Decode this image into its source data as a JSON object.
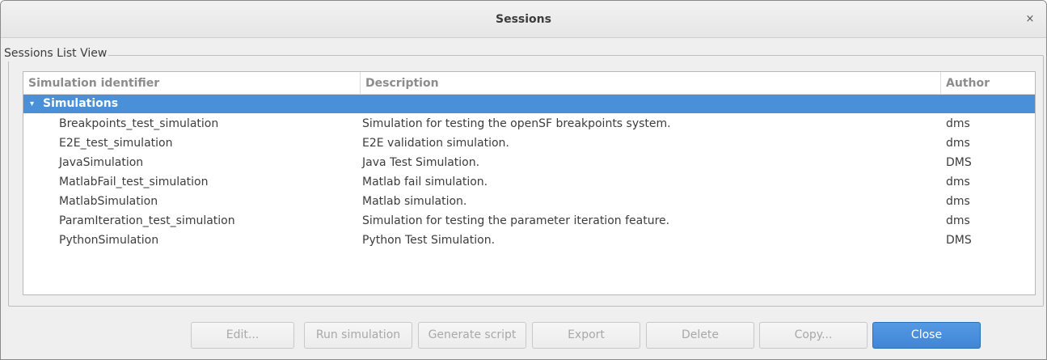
{
  "window": {
    "title": "Sessions",
    "close_glyph": "×"
  },
  "group": {
    "label": "Sessions List View"
  },
  "list": {
    "columns": [
      "Simulation identifier",
      "Description",
      "Author"
    ],
    "group_row": {
      "label": "Simulations",
      "expander": "▾",
      "color": "#4a90d9"
    },
    "rows": [
      {
        "id": "Breakpoints_test_simulation",
        "description": "Simulation for testing the openSF breakpoints system.",
        "author": "dms"
      },
      {
        "id": "E2E_test_simulation",
        "description": "E2E validation simulation.",
        "author": "dms"
      },
      {
        "id": "JavaSimulation",
        "description": "Java Test Simulation.",
        "author": "DMS"
      },
      {
        "id": "MatlabFail_test_simulation",
        "description": "Matlab fail simulation.",
        "author": "dms"
      },
      {
        "id": "MatlabSimulation",
        "description": "Matlab simulation.",
        "author": "dms"
      },
      {
        "id": "ParamIteration_test_simulation",
        "description": "Simulation for testing the parameter iteration feature.",
        "author": "dms"
      },
      {
        "id": "PythonSimulation",
        "description": "Python Test Simulation.",
        "author": "DMS"
      }
    ]
  },
  "buttons": {
    "edit": "Edit...",
    "run": "Run simulation",
    "generate": "Generate script",
    "export": "Export",
    "delete": "Delete",
    "copy": "Copy...",
    "close": "Close"
  }
}
